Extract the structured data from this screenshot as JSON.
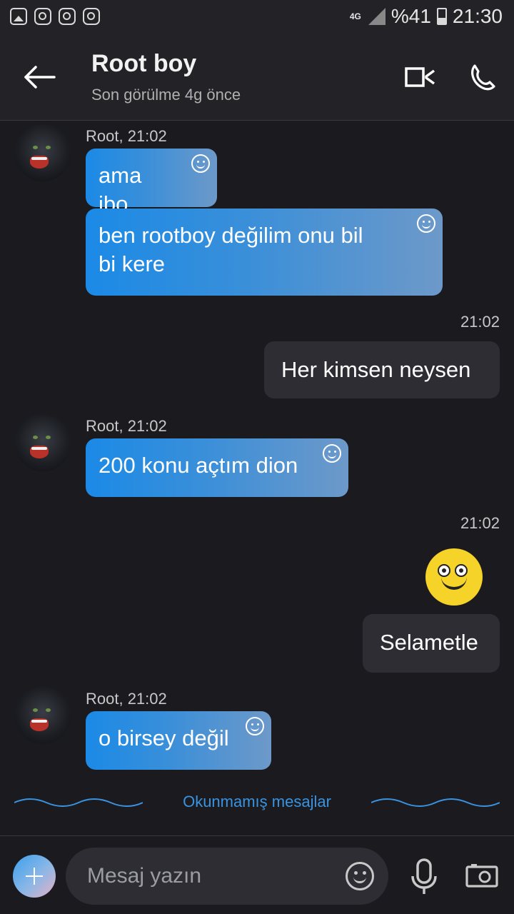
{
  "status_bar": {
    "network": "4G",
    "battery": "%41",
    "time": "21:30",
    "notification_icons": [
      "gallery-icon",
      "instagram-icon",
      "instagram-icon",
      "instagram-icon"
    ]
  },
  "header": {
    "contact_name": "Root boy",
    "last_seen": "Son görülme 4g önce"
  },
  "messages": [
    {
      "direction": "in",
      "sender": "Root, 21:02",
      "text": "ama ibo"
    },
    {
      "direction": "in",
      "text_line1": "ben rootboy değilim onu bil",
      "text_line2": "bi kere"
    },
    {
      "direction": "out",
      "time": "21:02",
      "text": "Her kimsen neysen"
    },
    {
      "direction": "in",
      "sender": "Root, 21:02",
      "text": "200 konu açtım dion"
    },
    {
      "direction": "out",
      "time": "21:02",
      "emoji": "smiley-emoji",
      "text": "Selametle"
    },
    {
      "direction": "in",
      "sender": "Root, 21:02",
      "text": "o birsey değil"
    }
  ],
  "unread_divider": "Okunmamış mesajlar",
  "composer": {
    "placeholder": "Mesaj yazın"
  },
  "colors": {
    "background": "#1b1b1f",
    "incoming_bubble_start": "#1b8ae6",
    "incoming_bubble_end": "#6d99c9",
    "outgoing_bubble": "#2d2d33",
    "accent": "#3a93e0"
  }
}
